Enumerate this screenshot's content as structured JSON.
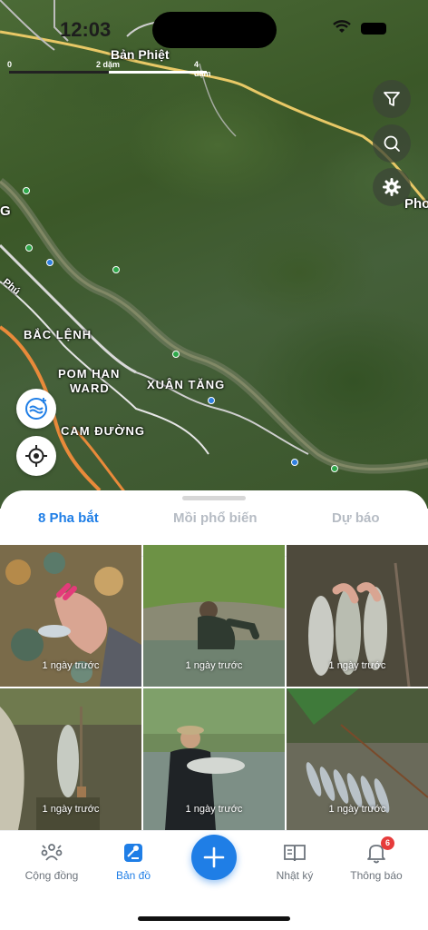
{
  "status_bar": {
    "time": "12:03"
  },
  "map": {
    "scale": {
      "ticks": [
        "0",
        "2 dặm",
        "4 dặm"
      ]
    },
    "labels": {
      "ban_phiet": "Bản Phiệt",
      "phong": "Pho",
      "left_g": "G",
      "phu": "Phú",
      "bac_lenh": "BẮC LỆNH",
      "pom_han_1": "POM HAN",
      "pom_han_2": "WARD",
      "xuan_tang": "XUÂN TĂNG",
      "cam_duong": "CAM ĐƯỜNG"
    },
    "buttons": [
      "filter-icon",
      "search-icon",
      "gear-icon",
      "water-layer-icon",
      "locate-icon"
    ]
  },
  "tabs": [
    {
      "label": "8 Pha bắt"
    },
    {
      "label": "Mồi phổ biến"
    },
    {
      "label": "Dự báo"
    }
  ],
  "catches": [
    {
      "ago": "1 ngày trước"
    },
    {
      "ago": "1 ngày trước"
    },
    {
      "ago": "1 ngày trước"
    },
    {
      "ago": "1 ngày trước"
    },
    {
      "ago": "1 ngày trước"
    },
    {
      "ago": "1 ngày trước"
    }
  ],
  "bottom_nav": {
    "community": "Cộng đồng",
    "map": "Bản đồ",
    "journal": "Nhật ký",
    "notifications": "Thông báo",
    "notifications_badge": "6"
  },
  "colors": {
    "accent": "#1f7ee6",
    "badge": "#e63b3b"
  }
}
